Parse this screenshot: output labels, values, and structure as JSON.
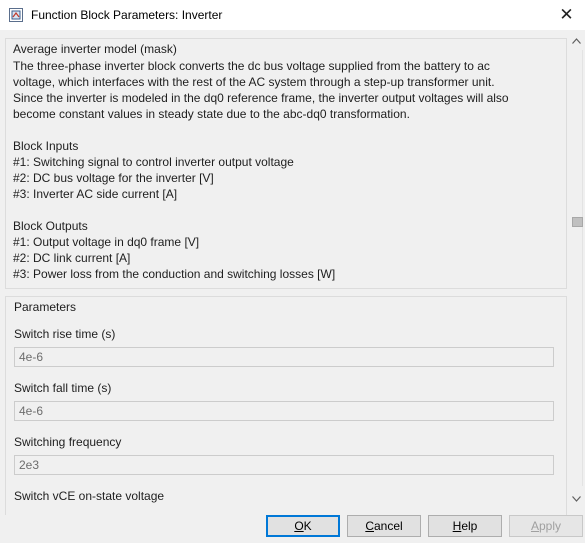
{
  "window": {
    "title": "Function Block Parameters: Inverter",
    "close_glyph": "✕"
  },
  "description": {
    "label": "Average inverter model (mask)",
    "lines": [
      "The three-phase inverter block converts the dc bus voltage supplied from the battery to ac",
      "voltage, which interfaces with the rest of the AC system through a step-up transformer unit.",
      "Since the inverter is modeled in the dq0 reference frame, the inverter output voltages will also",
      "become constant values in steady state due to the abc-dq0 transformation.",
      "",
      "Block Inputs",
      "#1: Switching signal to control inverter output voltage",
      "#2: DC bus voltage for the inverter [V]",
      "#3: Inverter AC side current [A]",
      "",
      "Block Outputs",
      "#1: Output voltage in dq0 frame [V]",
      "#2: DC link current [A]",
      "#3: Power loss from the conduction and switching losses [W]"
    ]
  },
  "parameters": {
    "label": "Parameters",
    "items": [
      {
        "label": "Switch rise time (s)",
        "value": "4e-6"
      },
      {
        "label": "Switch fall time (s)",
        "value": "4e-6"
      },
      {
        "label": "Switching frequency",
        "value": "2e3"
      },
      {
        "label": "Switch vCE on-state voltage"
      }
    ]
  },
  "buttons": {
    "ok": {
      "first": "O",
      "rest": "K"
    },
    "cancel": {
      "first": "C",
      "rest": "ancel"
    },
    "help": {
      "first": "H",
      "rest": "elp"
    },
    "apply": {
      "first": "A",
      "rest": "pply"
    }
  },
  "icons": {
    "app": "simulink-block-icon",
    "close": "close-icon",
    "scroll_up": "scroll-up-arrow-icon",
    "scroll_down": "scroll-down-arrow-icon"
  }
}
